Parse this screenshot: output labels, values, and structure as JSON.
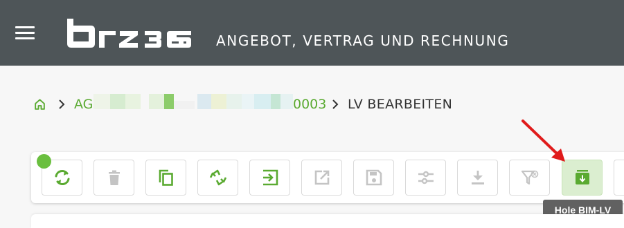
{
  "header": {
    "app_title": "ANGEBOT, VERTRAG UND RECHNUNG",
    "logo_text": "brz 365",
    "background_color": "#4e5558"
  },
  "breadcrumb": {
    "home_icon": "home-icon",
    "project_prefix": "AG",
    "project_suffix": "0003",
    "current": "LV BEARBEITEN"
  },
  "toolbar": {
    "status_color": "#6abf3f",
    "buttons": [
      {
        "icon": "refresh-icon",
        "enabled": true
      },
      {
        "icon": "trash-icon",
        "enabled": false
      },
      {
        "icon": "copy-icon",
        "enabled": true
      },
      {
        "icon": "sync-icon",
        "enabled": true
      },
      {
        "icon": "import-icon",
        "enabled": true
      },
      {
        "icon": "open-external-icon",
        "enabled": false
      },
      {
        "icon": "save-icon",
        "enabled": false
      },
      {
        "icon": "sliders-icon",
        "enabled": false
      },
      {
        "icon": "download-icon",
        "enabled": false
      },
      {
        "icon": "filter-clear-icon",
        "enabled": false
      },
      {
        "icon": "get-bim-lv-icon",
        "enabled": true,
        "active": true
      }
    ]
  },
  "tooltip": {
    "text": "Hole BIM-LV"
  },
  "colors": {
    "accent_green": "#5aaa31",
    "disabled_grey": "#c4c4c4"
  }
}
